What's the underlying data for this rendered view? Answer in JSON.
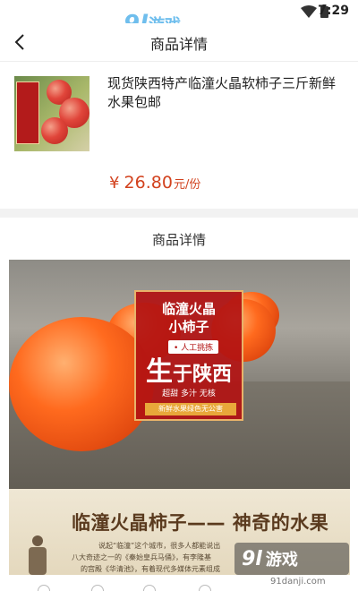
{
  "status_bar": {
    "time": "7:29"
  },
  "watermark": {
    "number": "9l",
    "label": "游戏",
    "url": "91danji.com"
  },
  "nav": {
    "title": "商品详情"
  },
  "product": {
    "name": "现货陕西特产临潼火晶软柿子三斤新鲜水果包邮",
    "price_symbol": "¥",
    "price": "26.80",
    "price_unit": "元/份"
  },
  "detail": {
    "heading": "商品详情",
    "poster": {
      "line1": "临潼火晶",
      "line2": "小柿子",
      "tag": "• 人工挑拣",
      "big1": "生",
      "big2": "于陕西",
      "sub": "超甜  多汁  无核",
      "strip": "新鲜水果绿色无公害"
    },
    "banner": {
      "title": "临潼火晶柿子——  神奇的水果",
      "text1": "说起“临潼”这个城市，很多人都能说出",
      "text2": "八大奇迹之一的《秦始皇兵马俑》，有李隆基",
      "text3": "的宫殿《华清池》，有着现代多媒体元素组成"
    }
  },
  "colors": {
    "price": "#d2421e",
    "poster_red": "#b31212",
    "brand_blue": "#3fa9e8"
  },
  "icons": {
    "back": "chevron-left-icon",
    "wifi": "wifi-icon",
    "battery": "battery-icon"
  }
}
